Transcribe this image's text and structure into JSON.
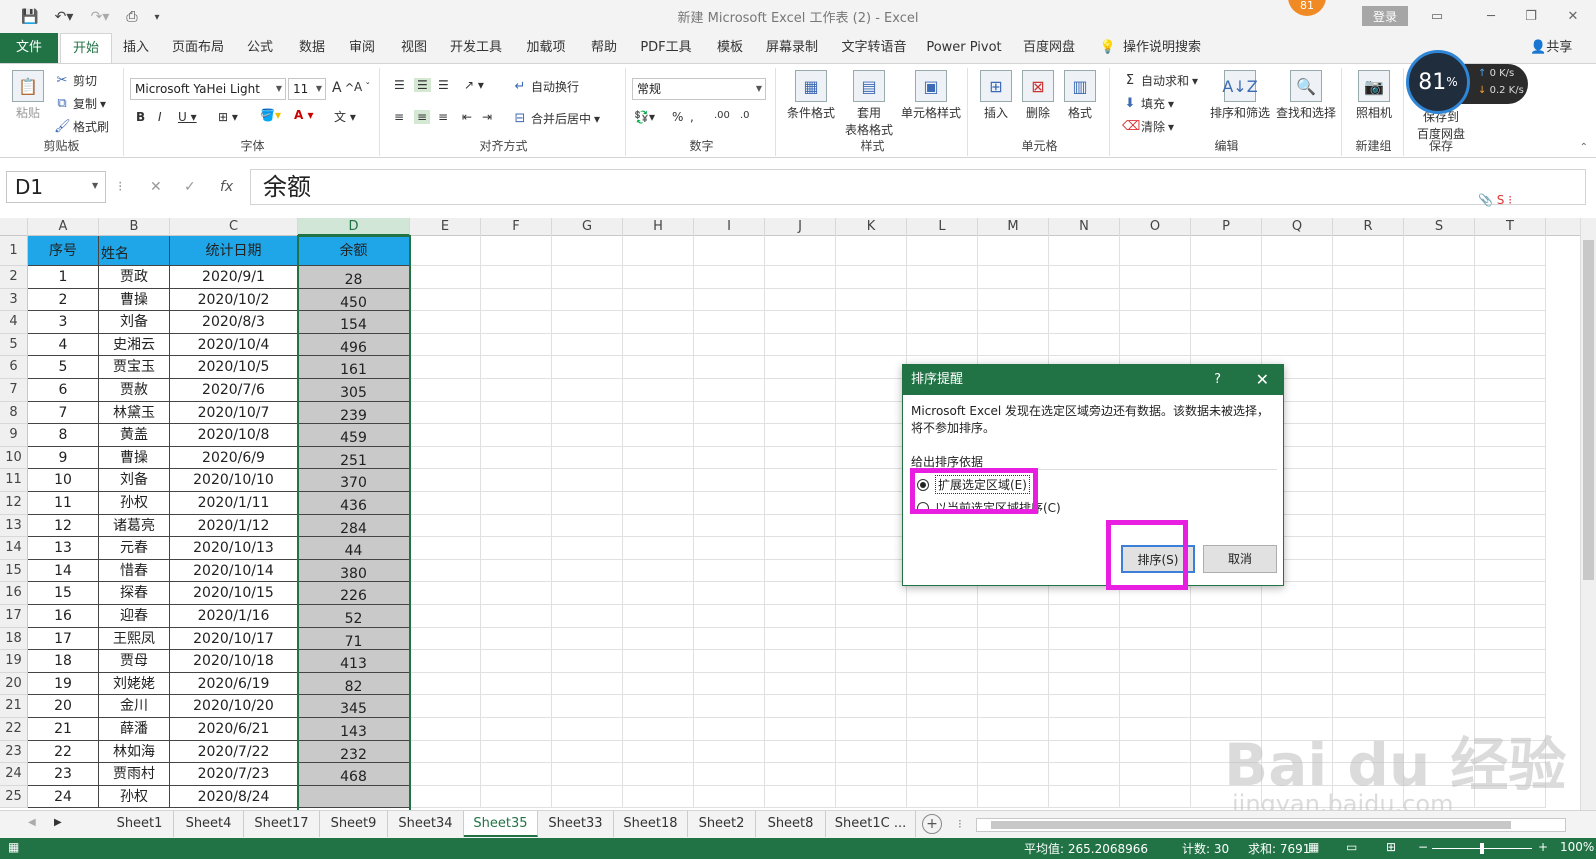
{
  "window": {
    "title": "新建 Microsoft Excel 工作表 (2)  -  Excel",
    "login": "登录",
    "badge": "81"
  },
  "tabs": [
    "文件",
    "开始",
    "插入",
    "页面布局",
    "公式",
    "数据",
    "审阅",
    "视图",
    "开发工具",
    "加载项",
    "帮助",
    "PDF工具",
    "模板",
    "屏幕录制",
    "文字转语音",
    "Power Pivot",
    "百度网盘",
    "操作说明搜索"
  ],
  "share": "共享",
  "ribbon": {
    "clipboard": {
      "paste": "粘贴",
      "cut": "剪切",
      "copy": "复制",
      "format_painter": "格式刷",
      "label": "剪贴板"
    },
    "font": {
      "name": "Microsoft YaHei Light",
      "size": "11",
      "label": "字体"
    },
    "align": {
      "wrap": "自动换行",
      "merge": "合并后居中",
      "label": "对齐方式"
    },
    "number": {
      "format": "常规",
      "label": "数字"
    },
    "styles": {
      "cond": "条件格式",
      "table": "套用\n表格格式",
      "cell": "单元格样式",
      "label": "样式"
    },
    "cells": {
      "insert": "插入",
      "delete": "删除",
      "format": "格式",
      "label": "单元格"
    },
    "edit": {
      "autosum": "自动求和",
      "fill": "填充",
      "clear": "清除",
      "sort": "排序和筛选",
      "find": "查找和选择",
      "label": "编辑"
    },
    "newgroup": {
      "camera": "照相机",
      "label": "新建组"
    },
    "save": {
      "btn": "保存到\n百度网盘",
      "label": "保存"
    }
  },
  "speed": {
    "percent": "81",
    "up": "0 K/s",
    "down": "0.2 K/s"
  },
  "formula": {
    "namebox": "D1",
    "content": "余额"
  },
  "columns": [
    "A",
    "B",
    "C",
    "D",
    "E",
    "F",
    "G",
    "H",
    "I",
    "J",
    "K",
    "L",
    "M",
    "N",
    "O",
    "P",
    "Q",
    "R",
    "S",
    "T"
  ],
  "table": {
    "headers": [
      "序号",
      "姓名",
      "统计日期",
      "余额"
    ],
    "rows": [
      [
        "1",
        "贾政",
        "2020/9/1",
        "28"
      ],
      [
        "2",
        "曹操",
        "2020/10/2",
        "450"
      ],
      [
        "3",
        "刘备",
        "2020/8/3",
        "154"
      ],
      [
        "4",
        "史湘云",
        "2020/10/4",
        "496"
      ],
      [
        "5",
        "贾宝玉",
        "2020/10/5",
        "161"
      ],
      [
        "6",
        "贾赦",
        "2020/7/6",
        "305"
      ],
      [
        "7",
        "林黛玉",
        "2020/10/7",
        "239"
      ],
      [
        "8",
        "黄盖",
        "2020/10/8",
        "459"
      ],
      [
        "9",
        "曹操",
        "2020/6/9",
        "251"
      ],
      [
        "10",
        "刘备",
        "2020/10/10",
        "370"
      ],
      [
        "11",
        "孙权",
        "2020/1/11",
        "436"
      ],
      [
        "12",
        "诸葛亮",
        "2020/1/12",
        "284"
      ],
      [
        "13",
        "元春",
        "2020/10/13",
        "44"
      ],
      [
        "14",
        "惜春",
        "2020/10/14",
        "380"
      ],
      [
        "15",
        "探春",
        "2020/10/15",
        "226"
      ],
      [
        "16",
        "迎春",
        "2020/1/16",
        "52"
      ],
      [
        "17",
        "王熙凤",
        "2020/10/17",
        "71"
      ],
      [
        "18",
        "贾母",
        "2020/10/18",
        "413"
      ],
      [
        "19",
        "刘姥姥",
        "2020/6/19",
        "82"
      ],
      [
        "20",
        "金川",
        "2020/10/20",
        "345"
      ],
      [
        "21",
        "薛潘",
        "2020/6/21",
        "143"
      ],
      [
        "22",
        "林如海",
        "2020/7/22",
        "232"
      ],
      [
        "23",
        "贾雨村",
        "2020/7/23",
        "468"
      ],
      [
        "24",
        "孙权",
        "2020/8/24",
        ""
      ]
    ]
  },
  "dialog": {
    "title": "排序提醒",
    "help": "?",
    "close": "✕",
    "message": "Microsoft Excel 发现在选定区域旁边还有数据。该数据未被选择，将不参加排序。",
    "subtitle": "给出排序依据",
    "option1": "扩展选定区域(E)",
    "option2": "以当前选定区域排序(C)",
    "sort_btn": "排序(S)",
    "cancel_btn": "取消"
  },
  "sheets": [
    "Sheet1",
    "Sheet4",
    "Sheet17",
    "Sheet9",
    "Sheet34",
    "Sheet35",
    "Sheet33",
    "Sheet18",
    "Sheet2",
    "Sheet8",
    "Sheet1C ..."
  ],
  "active_sheet": "Sheet35",
  "status": {
    "avg": "平均值: 265.2068966",
    "count": "计数: 30",
    "sum": "求和: 7691",
    "zoom": "100%"
  },
  "watermark": {
    "main": "Bai du 经验",
    "sub": "jingyan.baidu.com"
  }
}
